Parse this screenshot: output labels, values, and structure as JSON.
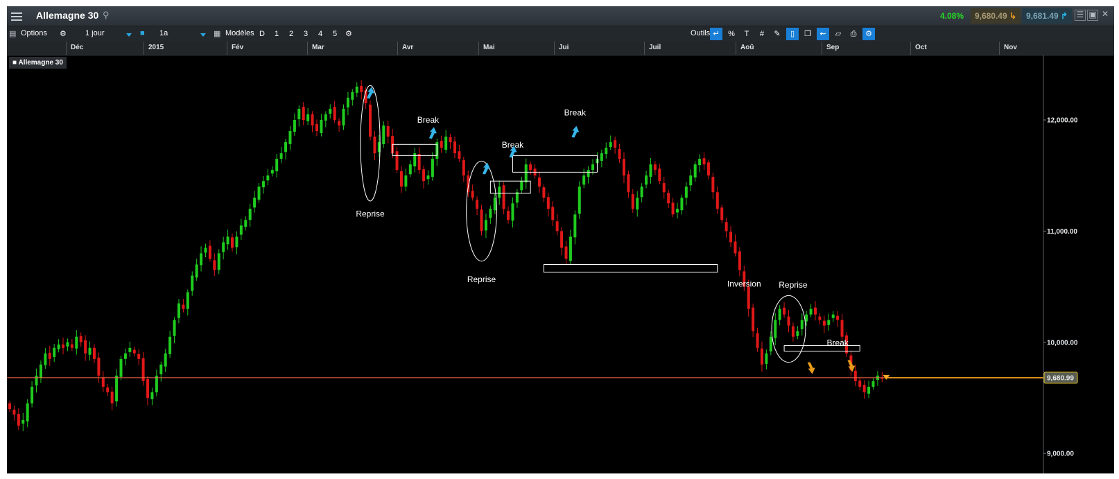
{
  "instrument": {
    "title": "Allemagne 30",
    "change_pct": "4.08%",
    "sell": "9,680.49",
    "buy": "9,681.49",
    "current_price_label": "9,680.99"
  },
  "toolbar": {
    "options_label": "Options",
    "interval": "1 jour",
    "range": "1a",
    "templates_label": "Modèles",
    "periods": [
      "D",
      "1",
      "2",
      "3",
      "4",
      "5"
    ],
    "tools_label": "Outils",
    "tools": [
      "arrow-tool-icon",
      "percent-tool-icon",
      "text-tool-icon",
      "grid-tool-icon",
      "pen-tool-icon",
      "candle-tool-icon",
      "layers-tool-icon",
      "bars-tool-icon",
      "label-tool-icon",
      "print-icon",
      "settings-tool-icon"
    ]
  },
  "colors": {
    "up": "#1fcc1f",
    "down": "#e01818",
    "price_line": "#ff6a4d",
    "accent_blue": "#1a7fd6",
    "annotation_arrow_up": "#36b4e8",
    "annotation_arrow_down": "#e89a1a"
  },
  "chart_data": {
    "type": "candlestick",
    "title": "Allemagne 30",
    "x_axis_labels": [
      "Déc",
      "2015",
      "Fév",
      "Mar",
      "Avr",
      "Mai",
      "Jui",
      "Juil",
      "Aoû",
      "Sep",
      "Oct",
      "Nov"
    ],
    "y_axis_ticks": [
      9000,
      10000,
      11000,
      12000
    ],
    "y_tick_labels": [
      "9,000.00",
      "10,000.00",
      "11,000.00",
      "12,000.00"
    ],
    "ylim": [
      8820,
      12580
    ],
    "current_price": 9680.99,
    "legend": "top-left",
    "grid": false,
    "closes": [
      9400,
      9350,
      9250,
      9300,
      9450,
      9600,
      9700,
      9800,
      9900,
      9850,
      9950,
      9980,
      9950,
      10000,
      9950,
      10050,
      10000,
      9900,
      9950,
      9850,
      9700,
      9600,
      9550,
      9450,
      9700,
      9850,
      9900,
      9950,
      9900,
      9850,
      9650,
      9500,
      9550,
      9700,
      9800,
      9900,
      10050,
      10200,
      10350,
      10300,
      10450,
      10600,
      10700,
      10800,
      10850,
      10750,
      10650,
      10800,
      10900,
      10950,
      10850,
      10950,
      11050,
      11100,
      11200,
      11300,
      11400,
      11450,
      11500,
      11550,
      11650,
      11700,
      11800,
      11900,
      12000,
      12100,
      12000,
      12050,
      11950,
      11900,
      12000,
      12050,
      12100,
      12000,
      11950,
      12100,
      12200,
      12250,
      12300,
      12250,
      12150,
      11850,
      11700,
      11800,
      11950,
      11850,
      11700,
      11550,
      11400,
      11500,
      11600,
      11700,
      11550,
      11450,
      11500,
      11650,
      11800,
      11750,
      11850,
      11800,
      11700,
      11650,
      11500,
      11350,
      11300,
      11200,
      11000,
      11100,
      11200,
      11300,
      11400,
      11200,
      11100,
      11250,
      11350,
      11450,
      11600,
      11550,
      11500,
      11400,
      11300,
      11200,
      11100,
      11000,
      10850,
      10750,
      10950,
      11150,
      11400,
      11500,
      11550,
      11600,
      11650,
      11700,
      11750,
      11800,
      11750,
      11650,
      11500,
      11350,
      11200,
      11300,
      11400,
      11500,
      11600,
      11550,
      11450,
      11350,
      11250,
      11150,
      11200,
      11300,
      11400,
      11500,
      11600,
      11650,
      11600,
      11500,
      11350,
      11200,
      11100,
      11000,
      10900,
      10800,
      10650,
      10500,
      10300,
      10100,
      9950,
      9800,
      9900,
      10050,
      10200,
      10300,
      10250,
      10150,
      10050,
      10100,
      10200,
      10250,
      10300,
      10250,
      10200,
      10150,
      10200,
      10250,
      10200,
      10050,
      9900,
      9750,
      9650,
      9600,
      9550,
      9600,
      9650,
      9700,
      9680
    ]
  },
  "annotations": {
    "labels": [
      {
        "text": "Reprise",
        "x": 81,
        "y": 11130
      },
      {
        "text": "Reprise",
        "x": 106,
        "y": 10540
      },
      {
        "text": "Reprise",
        "x": 176,
        "y": 10490
      },
      {
        "text": "Break",
        "x": 94,
        "y": 11975
      },
      {
        "text": "Break",
        "x": 113,
        "y": 11750
      },
      {
        "text": "Break",
        "x": 127,
        "y": 12040
      },
      {
        "text": "Break",
        "x": 186,
        "y": 9970
      },
      {
        "text": "Inversion",
        "x": 165,
        "y": 10500
      }
    ],
    "zones": [
      {
        "i0": 86,
        "i1": 96,
        "lo": 11680,
        "hi": 11780
      },
      {
        "i0": 108,
        "i1": 117,
        "lo": 11340,
        "hi": 11450
      },
      {
        "i0": 113,
        "i1": 132,
        "lo": 11530,
        "hi": 11680
      },
      {
        "i0": 120,
        "i1": 159,
        "lo": 10630,
        "hi": 10700
      },
      {
        "i0": 174,
        "i1": 191,
        "lo": 9920,
        "hi": 9970
      }
    ],
    "ellipses": [
      {
        "ci": 81,
        "cy": 11790,
        "ri": 2.2,
        "ry": 520
      },
      {
        "ci": 106,
        "cy": 11180,
        "ri": 3.4,
        "ry": 450
      },
      {
        "ci": 175,
        "cy": 10120,
        "ri": 3.8,
        "ry": 300
      }
    ],
    "arrows_up": [
      {
        "i": 81,
        "y": 12240
      },
      {
        "i": 95,
        "y": 11880
      },
      {
        "i": 107,
        "y": 11560
      },
      {
        "i": 113,
        "y": 11710
      },
      {
        "i": 127,
        "y": 11890
      }
    ],
    "arrows_down": [
      {
        "i": 180,
        "y": 9770
      },
      {
        "i": 189,
        "y": 9790
      }
    ]
  }
}
